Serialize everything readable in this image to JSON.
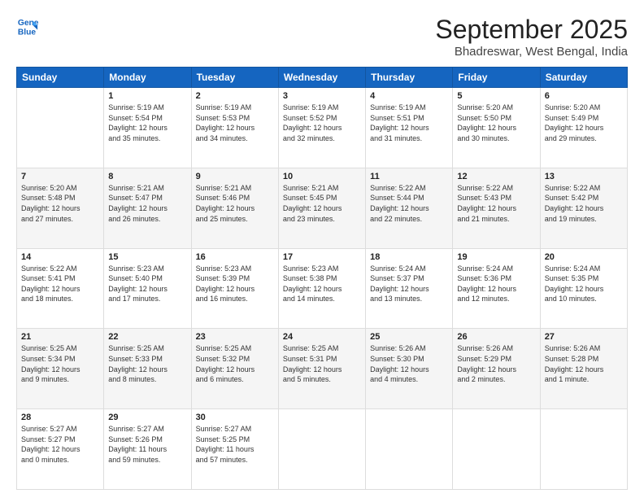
{
  "logo": {
    "line1": "General",
    "line2": "Blue"
  },
  "title": "September 2025",
  "subtitle": "Bhadreswar, West Bengal, India",
  "days_of_week": [
    "Sunday",
    "Monday",
    "Tuesday",
    "Wednesday",
    "Thursday",
    "Friday",
    "Saturday"
  ],
  "weeks": [
    [
      {
        "day": "",
        "text": ""
      },
      {
        "day": "1",
        "text": "Sunrise: 5:19 AM\nSunset: 5:54 PM\nDaylight: 12 hours\nand 35 minutes."
      },
      {
        "day": "2",
        "text": "Sunrise: 5:19 AM\nSunset: 5:53 PM\nDaylight: 12 hours\nand 34 minutes."
      },
      {
        "day": "3",
        "text": "Sunrise: 5:19 AM\nSunset: 5:52 PM\nDaylight: 12 hours\nand 32 minutes."
      },
      {
        "day": "4",
        "text": "Sunrise: 5:19 AM\nSunset: 5:51 PM\nDaylight: 12 hours\nand 31 minutes."
      },
      {
        "day": "5",
        "text": "Sunrise: 5:20 AM\nSunset: 5:50 PM\nDaylight: 12 hours\nand 30 minutes."
      },
      {
        "day": "6",
        "text": "Sunrise: 5:20 AM\nSunset: 5:49 PM\nDaylight: 12 hours\nand 29 minutes."
      }
    ],
    [
      {
        "day": "7",
        "text": "Sunrise: 5:20 AM\nSunset: 5:48 PM\nDaylight: 12 hours\nand 27 minutes."
      },
      {
        "day": "8",
        "text": "Sunrise: 5:21 AM\nSunset: 5:47 PM\nDaylight: 12 hours\nand 26 minutes."
      },
      {
        "day": "9",
        "text": "Sunrise: 5:21 AM\nSunset: 5:46 PM\nDaylight: 12 hours\nand 25 minutes."
      },
      {
        "day": "10",
        "text": "Sunrise: 5:21 AM\nSunset: 5:45 PM\nDaylight: 12 hours\nand 23 minutes."
      },
      {
        "day": "11",
        "text": "Sunrise: 5:22 AM\nSunset: 5:44 PM\nDaylight: 12 hours\nand 22 minutes."
      },
      {
        "day": "12",
        "text": "Sunrise: 5:22 AM\nSunset: 5:43 PM\nDaylight: 12 hours\nand 21 minutes."
      },
      {
        "day": "13",
        "text": "Sunrise: 5:22 AM\nSunset: 5:42 PM\nDaylight: 12 hours\nand 19 minutes."
      }
    ],
    [
      {
        "day": "14",
        "text": "Sunrise: 5:22 AM\nSunset: 5:41 PM\nDaylight: 12 hours\nand 18 minutes."
      },
      {
        "day": "15",
        "text": "Sunrise: 5:23 AM\nSunset: 5:40 PM\nDaylight: 12 hours\nand 17 minutes."
      },
      {
        "day": "16",
        "text": "Sunrise: 5:23 AM\nSunset: 5:39 PM\nDaylight: 12 hours\nand 16 minutes."
      },
      {
        "day": "17",
        "text": "Sunrise: 5:23 AM\nSunset: 5:38 PM\nDaylight: 12 hours\nand 14 minutes."
      },
      {
        "day": "18",
        "text": "Sunrise: 5:24 AM\nSunset: 5:37 PM\nDaylight: 12 hours\nand 13 minutes."
      },
      {
        "day": "19",
        "text": "Sunrise: 5:24 AM\nSunset: 5:36 PM\nDaylight: 12 hours\nand 12 minutes."
      },
      {
        "day": "20",
        "text": "Sunrise: 5:24 AM\nSunset: 5:35 PM\nDaylight: 12 hours\nand 10 minutes."
      }
    ],
    [
      {
        "day": "21",
        "text": "Sunrise: 5:25 AM\nSunset: 5:34 PM\nDaylight: 12 hours\nand 9 minutes."
      },
      {
        "day": "22",
        "text": "Sunrise: 5:25 AM\nSunset: 5:33 PM\nDaylight: 12 hours\nand 8 minutes."
      },
      {
        "day": "23",
        "text": "Sunrise: 5:25 AM\nSunset: 5:32 PM\nDaylight: 12 hours\nand 6 minutes."
      },
      {
        "day": "24",
        "text": "Sunrise: 5:25 AM\nSunset: 5:31 PM\nDaylight: 12 hours\nand 5 minutes."
      },
      {
        "day": "25",
        "text": "Sunrise: 5:26 AM\nSunset: 5:30 PM\nDaylight: 12 hours\nand 4 minutes."
      },
      {
        "day": "26",
        "text": "Sunrise: 5:26 AM\nSunset: 5:29 PM\nDaylight: 12 hours\nand 2 minutes."
      },
      {
        "day": "27",
        "text": "Sunrise: 5:26 AM\nSunset: 5:28 PM\nDaylight: 12 hours\nand 1 minute."
      }
    ],
    [
      {
        "day": "28",
        "text": "Sunrise: 5:27 AM\nSunset: 5:27 PM\nDaylight: 12 hours\nand 0 minutes."
      },
      {
        "day": "29",
        "text": "Sunrise: 5:27 AM\nSunset: 5:26 PM\nDaylight: 11 hours\nand 59 minutes."
      },
      {
        "day": "30",
        "text": "Sunrise: 5:27 AM\nSunset: 5:25 PM\nDaylight: 11 hours\nand 57 minutes."
      },
      {
        "day": "",
        "text": ""
      },
      {
        "day": "",
        "text": ""
      },
      {
        "day": "",
        "text": ""
      },
      {
        "day": "",
        "text": ""
      }
    ]
  ]
}
